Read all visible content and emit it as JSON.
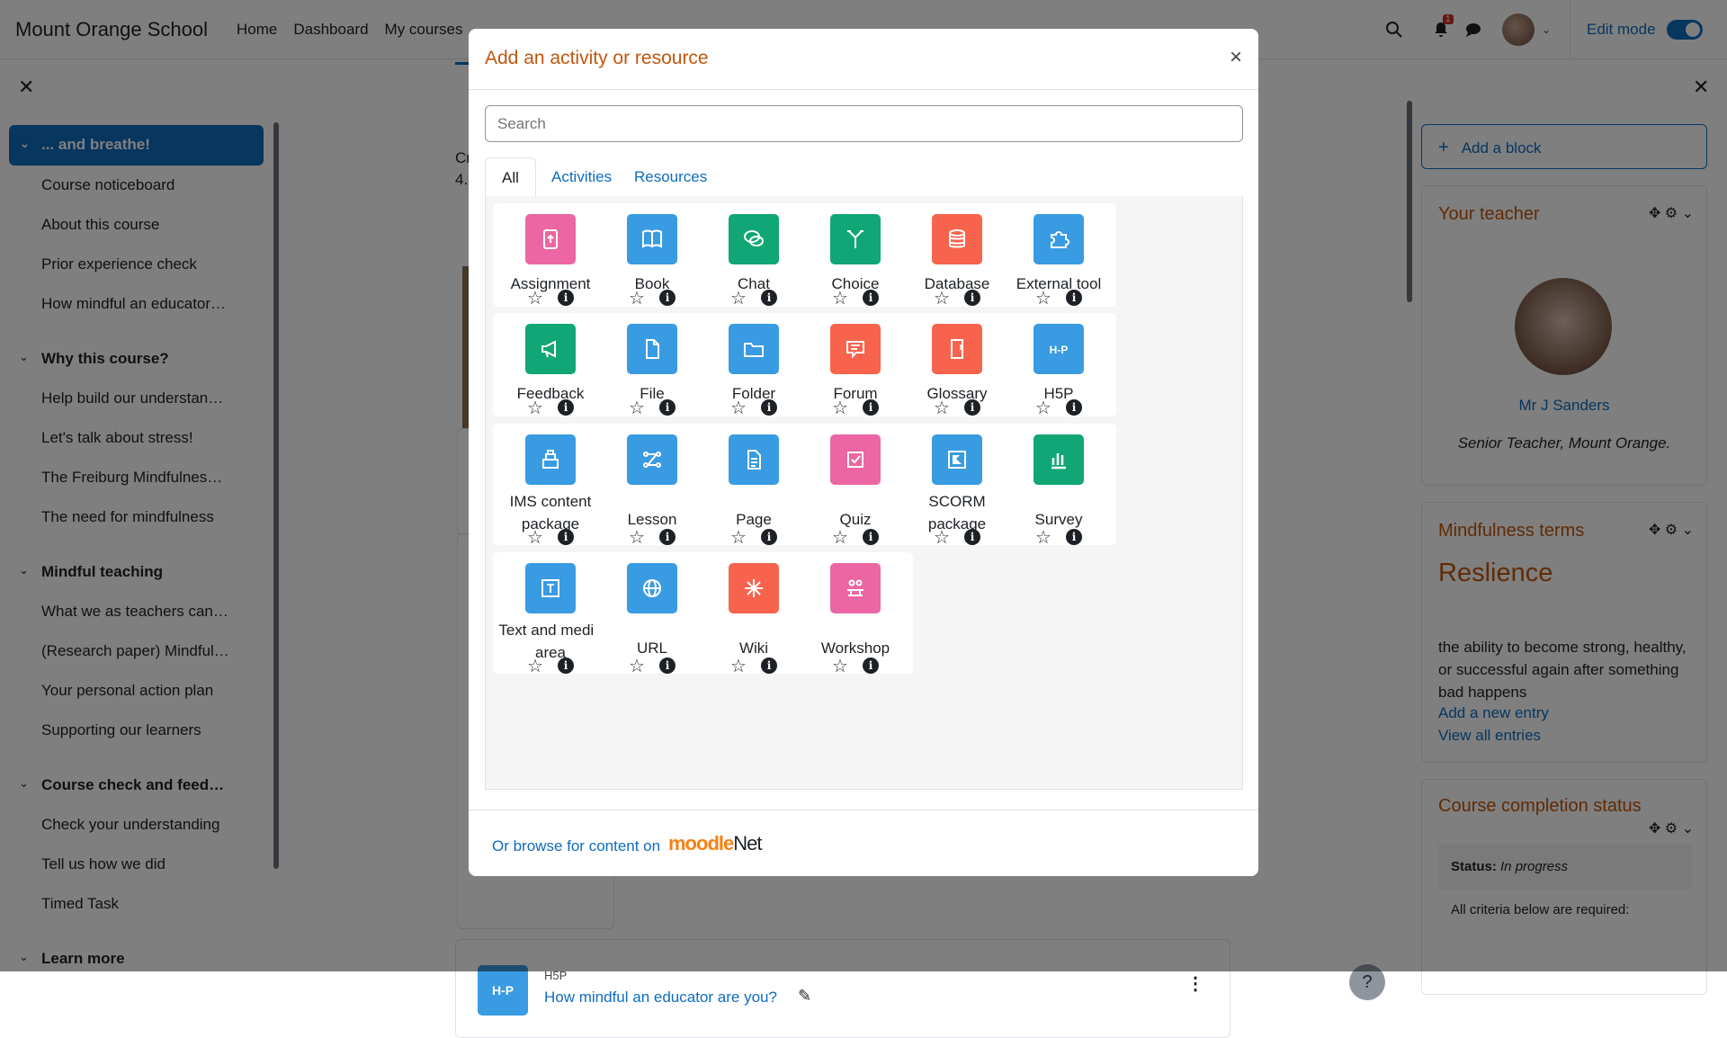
{
  "nav": {
    "brand": "Mount Orange School",
    "links": [
      "Home",
      "Dashboard",
      "My courses"
    ],
    "notif_count": "1",
    "edit_mode": "Edit mode"
  },
  "left": {
    "active_section": "... and breathe!",
    "s1_items": [
      "Course noticeboard",
      "About this course",
      "Prior experience check",
      "How mindful an educator…"
    ],
    "s2": "Why this course?",
    "s2_items": [
      "Help build our understan…",
      "Let's talk about stress!",
      "The Freiburg Mindfulnes…",
      "The need for mindfulness"
    ],
    "s3": "Mindful teaching",
    "s3_items": [
      "What we as teachers can…",
      "(Research paper) Mindful…",
      "Your personal action plan",
      "Supporting our learners"
    ],
    "s4": "Course check and feed…",
    "s4_items": [
      "Check your understanding",
      "Tell us how we did",
      "Timed Task"
    ],
    "s5": "Learn more"
  },
  "main": {
    "h5p_type": "H5P",
    "h5p_title": "How mindful an educator are you?",
    "h5p_icon": "H-P",
    "frag1": "Cr",
    "frag2": "4.",
    "help": "?"
  },
  "right": {
    "add_block": "Add a block",
    "teacher_title": "Your teacher",
    "teacher_name": "Mr J Sanders",
    "teacher_role": "Senior Teacher, Mount Orange.",
    "terms_title": "Mindfulness terms",
    "term": "Reslience",
    "term_def": "the ability to become strong, healthy, or successful again after something bad happens",
    "add_entry": "Add a new entry",
    "view_all": "View all entries",
    "completion_title": "Course completion status",
    "status_label": "Status:",
    "status_value": "In progress",
    "criteria": "All criteria below are required:"
  },
  "modal": {
    "title": "Add an activity or resource",
    "search_placeholder": "Search",
    "tabs": [
      "All",
      "Activities",
      "Resources"
    ],
    "items": [
      {
        "name": "Assignment",
        "color": "#eb66a2",
        "icon": "assignment-icon"
      },
      {
        "name": "Book",
        "color": "#399be2",
        "icon": "book-icon"
      },
      {
        "name": "Chat",
        "color": "#11a676",
        "icon": "chat-icon"
      },
      {
        "name": "Choice",
        "color": "#11a676",
        "icon": "choice-icon"
      },
      {
        "name": "Database",
        "color": "#f7634d",
        "icon": "database-icon"
      },
      {
        "name": "External tool",
        "color": "#399be2",
        "icon": "puzzle-icon"
      },
      {
        "name": "Feedback",
        "color": "#11a676",
        "icon": "megaphone-icon"
      },
      {
        "name": "File",
        "color": "#399be2",
        "icon": "file-icon"
      },
      {
        "name": "Folder",
        "color": "#399be2",
        "icon": "folder-icon"
      },
      {
        "name": "Forum",
        "color": "#f7634d",
        "icon": "forum-icon"
      },
      {
        "name": "Glossary",
        "color": "#f7634d",
        "icon": "glossary-icon"
      },
      {
        "name": "H5P",
        "color": "#399be2",
        "icon": "h5p-icon"
      },
      {
        "name": "IMS content package",
        "color": "#399be2",
        "icon": "ims-icon"
      },
      {
        "name": "Lesson",
        "color": "#399be2",
        "icon": "lesson-icon"
      },
      {
        "name": "Page",
        "color": "#399be2",
        "icon": "page-icon"
      },
      {
        "name": "Quiz",
        "color": "#eb66a2",
        "icon": "quiz-icon"
      },
      {
        "name": "SCORM package",
        "color": "#399be2",
        "icon": "scorm-icon"
      },
      {
        "name": "Survey",
        "color": "#11a676",
        "icon": "survey-icon"
      },
      {
        "name": "Text and media area",
        "color": "#399be2",
        "icon": "text-icon"
      },
      {
        "name": "URL",
        "color": "#399be2",
        "icon": "globe-icon"
      },
      {
        "name": "Wiki",
        "color": "#f7634d",
        "icon": "wiki-icon"
      },
      {
        "name": "Workshop",
        "color": "#eb66a2",
        "icon": "workshop-icon"
      }
    ],
    "footer_text": "Or browse for content on",
    "moodle": "moodle",
    "net": "Net"
  }
}
